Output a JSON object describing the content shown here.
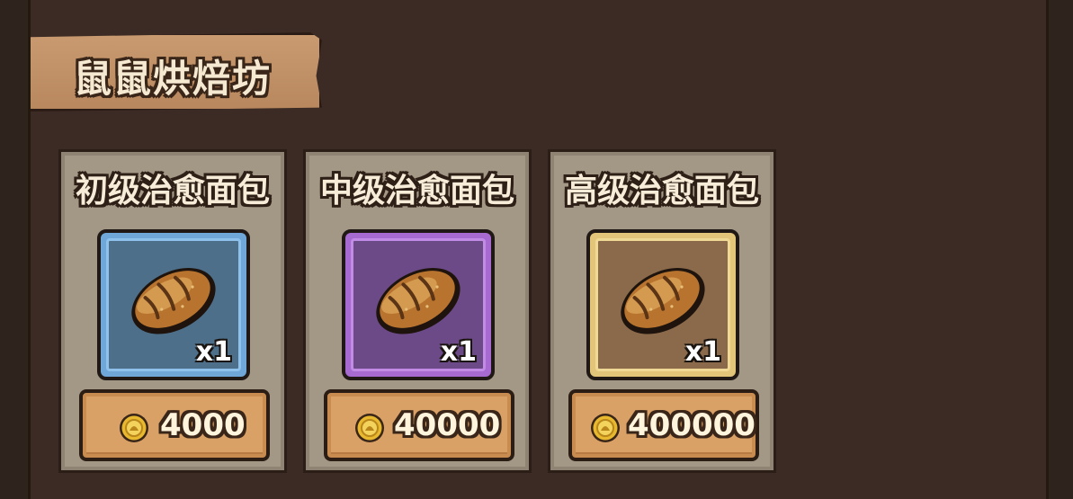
{
  "shop": {
    "title": "鼠鼠烘焙坊"
  },
  "items": [
    {
      "name": "初级治愈面包",
      "quantity": "x1",
      "price": "4000",
      "rarity_color": "#6fa8d8",
      "icon": "bread-icon",
      "currency_icon": "gold-coin-icon"
    },
    {
      "name": "中级治愈面包",
      "quantity": "x1",
      "price": "40000",
      "rarity_color": "#a66ad1",
      "icon": "bread-icon",
      "currency_icon": "gold-coin-icon"
    },
    {
      "name": "高级治愈面包",
      "quantity": "x1",
      "price": "400000",
      "rarity_color": "#e2c579",
      "icon": "bread-icon",
      "currency_icon": "gold-coin-icon"
    }
  ]
}
